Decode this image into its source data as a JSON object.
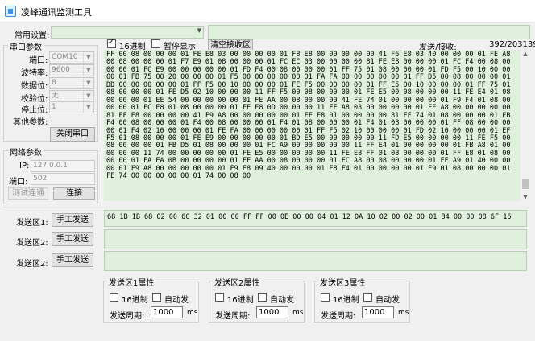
{
  "window": {
    "title": "凌峰通讯监测工具",
    "minimize": "—",
    "maximize": "☐",
    "close": "✕"
  },
  "top": {
    "common_settings_label": "常用设置:",
    "common_settings_value": "",
    "top_right_value": ""
  },
  "serial": {
    "group_title": "串口参数",
    "port_label": "端口:",
    "port_value": "COM10",
    "baud_label": "波特率:",
    "baud_value": "9600",
    "databits_label": "数据位:",
    "databits_value": "8",
    "parity_label": "校验位:",
    "parity_value": "无",
    "stopbits_label": "停止位:",
    "stopbits_value": "1",
    "other_label": "其他参数:",
    "close_button": "关闭串口"
  },
  "network": {
    "group_title": "网络参数",
    "ip_label": "IP:",
    "ip_value": "127.0.0.1",
    "port_label": "端口:",
    "port_value": "502",
    "test_button": "测试连通",
    "connect_button": "连接"
  },
  "receive": {
    "hex_label": "16进制",
    "hex_checked": true,
    "pause_label": "暂停显示",
    "pause_checked": false,
    "clear_button": "清空接收区",
    "stats_label": "发送/接收:",
    "stats_value": "392/203139",
    "content": "FF 00 08 00 00 00 01 FE E8 03 00 00 00 00 01 F8 E8 00 00 00 00 00 41 F6 E8 03 40 00 00 00 01 FE A8 00 08 00 00 00 01 F7 E9 01 08 00 00 00 01 FC EC 03 00 00 00 00 81 FE E8 00 00 00 01 FC F4 00 08 00 00 00 01 FC E9 00 00 00 00 00 01 FD F4 00 08 00 00 00 01 FF 75 01 08 00 00 00 01 FD F5 00 10 00 00 00 01 FB 75 00 20 00 00 00 01 F5 00 00 00 00 00 01 FA FA 00 00 00 00 00 01 FF D5 00 08 00 00 00 01 DD 00 00 00 00 00 01 FF F5 00 10 00 00 00 01 FE F5 00 00 00 00 01 FF E5 00 10 00 00 00 01 FF 75 01 08 00 00 00 01 FE D5 02 10 00 00 00 11 FF F5 00 08 00 00 00 01 FE E5 00 08 00 00 00 11 FE E4 01 08 00 00 00 01 EE 54 00 00 00 00 00 01 FE AA 00 08 00 00 00 41 FE 74 01 00 00 00 00 01 F9 F4 01 08 00 00 00 01 FC E8 01 08 00 00 00 01 FE E8 0D 00 00 00 11 FF A8 03 00 00 00 00 01 FE A8 00 00 00 00 00 81 FF E8 00 00 00 00 41 F9 A8 00 00 00 00 00 01 FF E8 01 00 00 00 00 81 FF 74 01 08 00 00 00 01 FB F4 00 08 00 00 00 01 F4 00 08 00 00 00 01 F4 01 08 00 00 00 01 F4 01 08 00 00 00 01 FF 08 00 00 00 00 01 F4 02 10 00 00 00 01 FE FA 00 00 00 00 00 01 FF F5 02 10 00 00 00 01 FD 02 10 00 00 00 01 EF F5 01 08 00 00 00 01 FE E9 00 00 00 00 00 01 BD E5 00 00 00 00 00 11 FD E5 00 00 00 00 11 FE F5 00 08 00 00 00 01 FB D5 01 08 00 00 00 01 FC A9 00 00 00 00 00 11 FF E4 01 00 00 00 00 01 FB A8 01 00 00 00 00 11 74 00 00 00 00 00 01 FE E5 00 00 00 00 00 11 FE E8 FF 01 08 00 00 00 01 FF E8 01 08 00 00 00 01 FA EA 0B 00 00 00 00 01 FF AA 00 08 00 00 00 01 FC A8 00 08 00 00 00 01 FE A9 01 40 00 00 00 01 F9 A8 00 00 00 00 00 01 F9 E8 09 40 00 00 00 01 F8 F4 01 00 00 00 00 01 E9 01 08 00 00 00 01 FE 74 00 00 00 00 00 01 74 00 08 00"
  },
  "send": {
    "rows": [
      {
        "label": "发送区1:",
        "button": "手工发送",
        "content": "68 1B 1B 68 02 00 6C 32 01 00 00 FF FF 00 0E 00 00 04 01 12 0A 10 02 00 02 00 01 84 00 00 08 6F 16"
      },
      {
        "label": "发送区2:",
        "button": "手工发送",
        "content": ""
      },
      {
        "label": "发送区2:",
        "button": "手工发送",
        "content": ""
      }
    ]
  },
  "properties": [
    {
      "title": "发送区1属性",
      "hex_label": "16进制",
      "auto_label": "自动发",
      "period_label": "发送周期:",
      "period_value": "1000",
      "unit": "ms"
    },
    {
      "title": "发送区2属性",
      "hex_label": "16进制",
      "auto_label": "自动发",
      "period_label": "发送周期:",
      "period_value": "1000",
      "unit": "ms"
    },
    {
      "title": "发送区3属性",
      "hex_label": "16进制",
      "auto_label": "自动发",
      "period_label": "发送周期:",
      "period_value": "1000",
      "unit": "ms"
    }
  ],
  "colors": {
    "green_area": "#dff0dc",
    "button_face": "#e1e1e1",
    "window_bg": "#f0f0f0"
  },
  "scroll": {
    "receive_position": 0.97
  }
}
